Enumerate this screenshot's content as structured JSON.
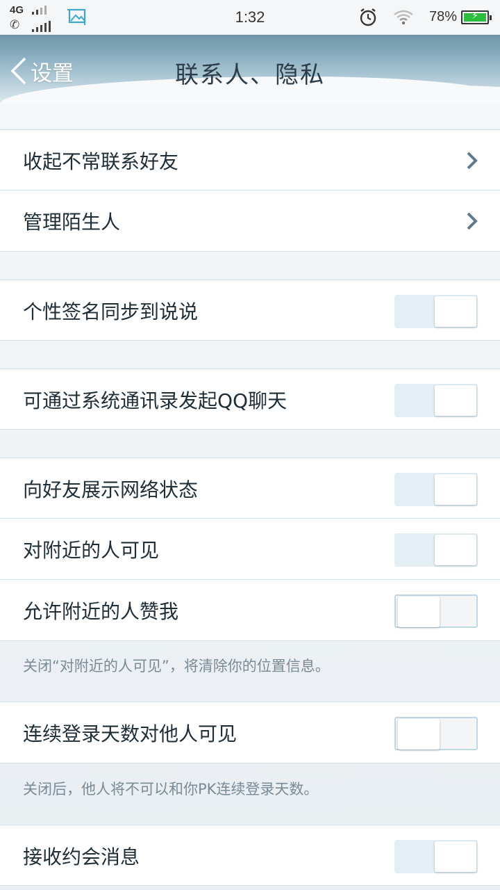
{
  "status_bar": {
    "network": "4G",
    "time": "1:32",
    "battery_percent": "78%",
    "battery_level": 0.78
  },
  "header": {
    "back_label": "设置",
    "title": "联系人、隐私"
  },
  "rows": {
    "hide_friends": {
      "label": "收起不常联系好友"
    },
    "manage_strangers": {
      "label": "管理陌生人"
    },
    "sync_signature": {
      "label": "个性签名同步到说说",
      "on": true
    },
    "contacts_chat": {
      "label": "可通过系统通讯录发起QQ聊天",
      "on": true
    },
    "network_status": {
      "label": "向好友展示网络状态",
      "on": true
    },
    "nearby_visible": {
      "label": "对附近的人可见",
      "on": true
    },
    "nearby_like": {
      "label": "允许附近的人赞我",
      "on": false
    },
    "login_days": {
      "label": "连续登录天数对他人可见",
      "on": false
    },
    "date_messages": {
      "label": "接收约会消息",
      "on": true
    }
  },
  "notes": {
    "nearby_note": "关闭“对附近的人可见”，将清除你的位置信息。",
    "login_note": "关闭后，他人将不可以和你PK连续登录天数。"
  },
  "colors": {
    "accent": "#3a9fd4",
    "toggle_on_bg": "#e3eff5",
    "divider": "#cfe1ea"
  }
}
